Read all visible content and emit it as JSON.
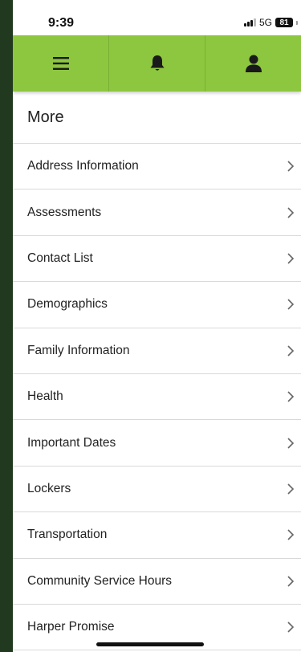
{
  "status_bar": {
    "time": "9:39",
    "network": "5G",
    "battery": "81"
  },
  "toolbar": {
    "menu_icon": "hamburger-menu-icon",
    "notification_icon": "bell-icon",
    "profile_icon": "user-icon",
    "bg_color": "#8dc63f"
  },
  "page": {
    "title": "More"
  },
  "menu": {
    "items": [
      {
        "label": "Address Information"
      },
      {
        "label": "Assessments"
      },
      {
        "label": "Contact List"
      },
      {
        "label": "Demographics"
      },
      {
        "label": "Family Information"
      },
      {
        "label": "Health"
      },
      {
        "label": "Important Dates"
      },
      {
        "label": "Lockers"
      },
      {
        "label": "Transportation"
      },
      {
        "label": "Community Service Hours"
      },
      {
        "label": "Harper Promise"
      }
    ]
  }
}
